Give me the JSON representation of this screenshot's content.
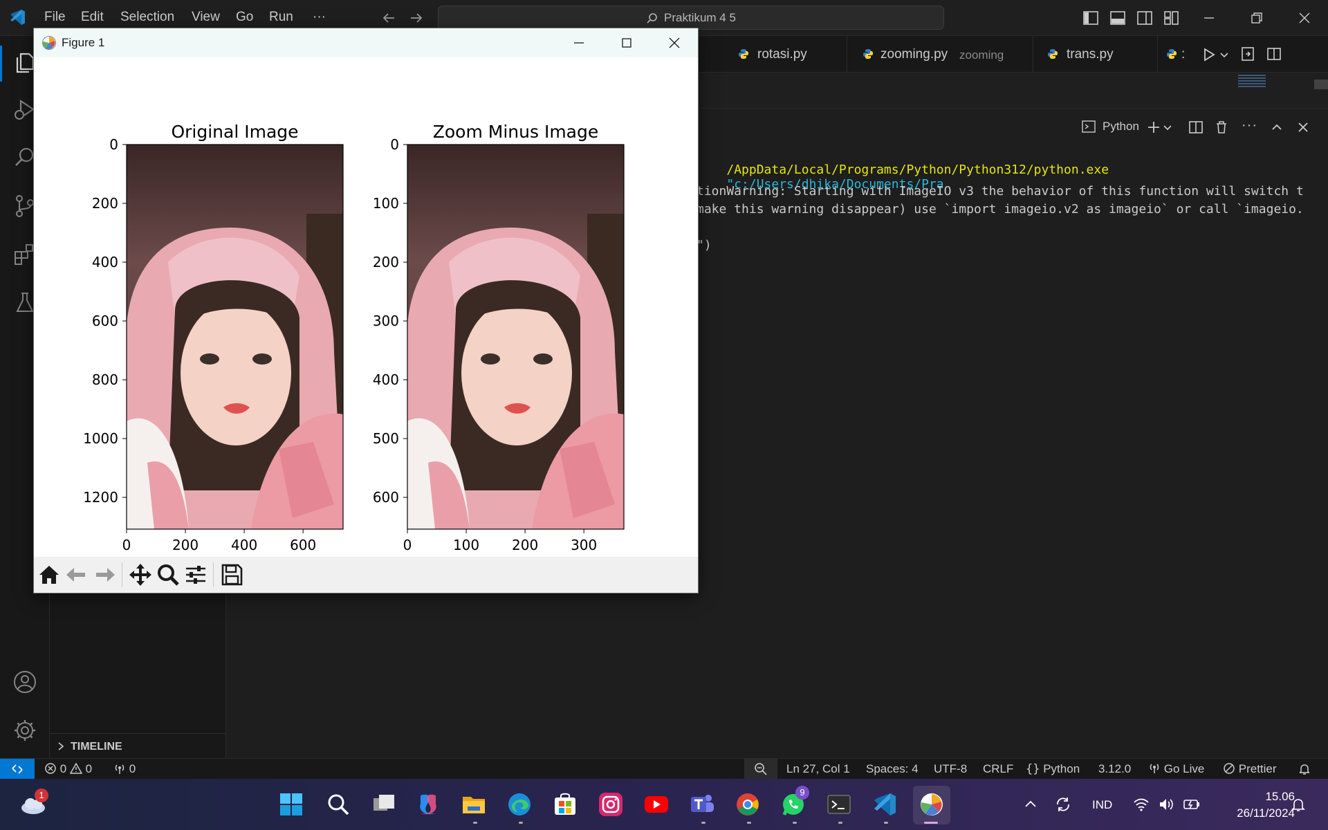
{
  "titlebar": {
    "menus": [
      "File",
      "Edit",
      "Selection",
      "View",
      "Go",
      "Run",
      "···"
    ],
    "search_text": "Praktikum 4 5"
  },
  "tabs": [
    {
      "name": "rotasi.py",
      "desc": ""
    },
    {
      "name": "zooming.py",
      "desc": "zooming"
    },
    {
      "name": "trans.py",
      "desc": ""
    }
  ],
  "tab_overflow": ":",
  "panel": {
    "terminal_name": "Python"
  },
  "terminal": {
    "line1_a": "/AppData/Local/Programs/Python/Python312/python.exe",
    "line1_b": "\"c:/Users/dhika/Documents/Pra",
    "line2": "tionWarning: Starting with ImageIO v3 the behavior of this function will switch t",
    "line3": "make this warning disappear) use `import imageio.v2 as imageio` or call `imageio.",
    "line4": "\")"
  },
  "figure": {
    "window_title": "Figure 1"
  },
  "chart_data": [
    {
      "type": "image",
      "title": "Original Image",
      "x_ticks": [
        "0",
        "200",
        "400",
        "600"
      ],
      "y_ticks": [
        "0",
        "200",
        "400",
        "600",
        "800",
        "1000",
        "1200"
      ],
      "xlim": [
        0,
        736
      ],
      "ylim": [
        1308,
        0
      ]
    },
    {
      "type": "image",
      "title": "Zoom Minus Image",
      "x_ticks": [
        "0",
        "100",
        "200",
        "300"
      ],
      "y_ticks": [
        "0",
        "100",
        "200",
        "300",
        "400",
        "500",
        "600"
      ],
      "xlim": [
        0,
        368
      ],
      "ylim": [
        654,
        0
      ]
    }
  ],
  "sidebar": {
    "timeline_label": "TIMELINE"
  },
  "statusbar": {
    "errors": "0",
    "warnings": "0",
    "ports": "0",
    "position": "Ln 27, Col 1",
    "spaces": "Spaces: 4",
    "encoding": "UTF-8",
    "eol": "CRLF",
    "language": "Python",
    "version": "3.12.0",
    "golive": "Go Live",
    "prettier": "Prettier"
  },
  "taskbar": {
    "weather_badge": "1",
    "whatsapp_badge": "9",
    "lang": "IND",
    "time": "15.06",
    "date": "26/11/2024"
  },
  "colors": {
    "accent_blue": "#0078d4",
    "terminal_yellow": "#e5e510",
    "terminal_cyan": "#29b8db"
  }
}
